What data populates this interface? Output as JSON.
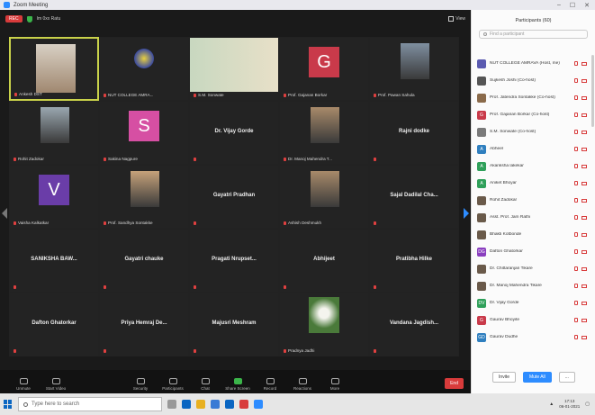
{
  "window": {
    "title": "Zoom Meeting"
  },
  "topbar": {
    "rec_label": "REC",
    "status_text": "Im 0xx Ratu",
    "view_label": "View"
  },
  "tiles": [
    {
      "name": "Ankesh DST",
      "center": "",
      "initial": "",
      "color": "",
      "kind": "photo",
      "active": true
    },
    {
      "name": "NUT COLLEGE AMRA...",
      "center": "",
      "initial": "",
      "color": "",
      "kind": "logo",
      "active": false
    },
    {
      "name": "S.M. Sonwate",
      "center": "",
      "initial": "",
      "color": "",
      "kind": "banner",
      "active": false
    },
    {
      "name": "Prof. Gajanan Borkar",
      "center": "",
      "initial": "G",
      "color": "#c93a4a",
      "kind": "avatar",
      "active": false
    },
    {
      "name": "Prof. Pawan Sahula",
      "center": "",
      "initial": "",
      "color": "",
      "kind": "photo",
      "active": false
    },
    {
      "name": "Rohit Zadokar",
      "center": "",
      "initial": "",
      "color": "",
      "kind": "photo",
      "active": false
    },
    {
      "name": "Sakina Nagpure",
      "center": "",
      "initial": "S",
      "color": "#d64fa3",
      "kind": "avatar",
      "active": false
    },
    {
      "name": "",
      "center": "Dr. Vijay Gorde",
      "initial": "",
      "color": "",
      "kind": "text",
      "active": false
    },
    {
      "name": "Dr. Manoj Mahendra T...",
      "center": "",
      "initial": "",
      "color": "",
      "kind": "photo",
      "active": false
    },
    {
      "name": "",
      "center": "Rajni dodke",
      "initial": "",
      "color": "",
      "kind": "text",
      "active": false
    },
    {
      "name": "Vaisha Kalkatkar",
      "center": "",
      "initial": "V",
      "color": "#6a3da8",
      "kind": "avatar",
      "active": false
    },
    {
      "name": "Prof. Sandhya Sontakke",
      "center": "",
      "initial": "",
      "color": "",
      "kind": "photo",
      "active": false
    },
    {
      "name": "",
      "center": "Gayatri Pradhan",
      "initial": "",
      "color": "",
      "kind": "text",
      "active": false
    },
    {
      "name": "Ashish Deshmukh",
      "center": "",
      "initial": "",
      "color": "",
      "kind": "photo",
      "active": false
    },
    {
      "name": "",
      "center": "Sajal Dadilal Cha...",
      "initial": "",
      "color": "",
      "kind": "text",
      "active": false
    },
    {
      "name": "",
      "center": "SANIKSHA BAW...",
      "initial": "",
      "color": "",
      "kind": "text",
      "active": false
    },
    {
      "name": "",
      "center": "Gayatri chauke",
      "initial": "",
      "color": "",
      "kind": "text",
      "active": false
    },
    {
      "name": "",
      "center": "Pragati Nrupset...",
      "initial": "",
      "color": "",
      "kind": "text",
      "active": false
    },
    {
      "name": "",
      "center": "Abhijeet",
      "initial": "",
      "color": "",
      "kind": "text",
      "active": false
    },
    {
      "name": "",
      "center": "Pratibha Hilke",
      "initial": "",
      "color": "",
      "kind": "text",
      "active": false
    },
    {
      "name": "",
      "center": "Dafton Ghatorkar",
      "initial": "",
      "color": "",
      "kind": "text",
      "active": false
    },
    {
      "name": "",
      "center": "Priya Hemraj De...",
      "initial": "",
      "color": "",
      "kind": "text",
      "active": false
    },
    {
      "name": "",
      "center": "Majusri Meshram",
      "initial": "",
      "color": "",
      "kind": "text",
      "active": false
    },
    {
      "name": "Pradnya Jadhi",
      "center": "",
      "initial": "",
      "color": "",
      "kind": "flower",
      "active": false
    },
    {
      "name": "",
      "center": "Vandana Jagdish...",
      "initial": "",
      "color": "",
      "kind": "text",
      "active": false
    }
  ],
  "toolbar": {
    "items": [
      "Unmute",
      "Start Video",
      "Security",
      "Participants",
      "Chat",
      "Share Screen",
      "Record",
      "Reactions",
      "More"
    ],
    "end_label": "End"
  },
  "panel": {
    "title": "Participants (60)",
    "search_placeholder": "Find a participant",
    "participants": [
      {
        "name": "NUT COLLEGE AMRAVA (Host, me)",
        "initial": "",
        "color": "#5a5ab0"
      },
      {
        "name": "Sujkesh Joshi (Co-host)",
        "initial": "",
        "color": "#555"
      },
      {
        "name": "Prof. Jatendra Sontakke (Co-host)",
        "initial": "",
        "color": "#8a6a4a"
      },
      {
        "name": "Prof. Gajanan Borkar (Co-host)",
        "initial": "G",
        "color": "#c93a4a"
      },
      {
        "name": "S.M. Sonwate (Co-host)",
        "initial": "",
        "color": "#7a7a7a"
      },
      {
        "name": "Abheel",
        "initial": "A",
        "color": "#2f7fbf"
      },
      {
        "name": "Akanksha lakekar",
        "initial": "A",
        "color": "#2fa05a"
      },
      {
        "name": "Aniket Bhoyar",
        "initial": "A",
        "color": "#2fa05a"
      },
      {
        "name": "Rohit Zadokar",
        "initial": "",
        "color": "#6a5a4a"
      },
      {
        "name": "Asst. Prof. Jam Rathi",
        "initial": "",
        "color": "#6a5a4a"
      },
      {
        "name": "Bhakti Kotbonde",
        "initial": "",
        "color": "#6a5a4a"
      },
      {
        "name": "Dafton Ghatorkar",
        "initial": "DG",
        "color": "#8a3fbf"
      },
      {
        "name": "Dr. Chittaranjan Tikare",
        "initial": "",
        "color": "#6a5a4a"
      },
      {
        "name": "Dr. Manoj Mahendra Tikare",
        "initial": "",
        "color": "#6a5a4a"
      },
      {
        "name": "Dr. Vijay Gorde",
        "initial": "DV",
        "color": "#2fa05a"
      },
      {
        "name": "Gaurav Bhoyite",
        "initial": "G",
        "color": "#c93a4a"
      },
      {
        "name": "Gaurav Dudhe",
        "initial": "GD",
        "color": "#2f7fbf"
      }
    ],
    "footer": {
      "invite": "Invite",
      "mute_all": "Mute All",
      "more": "..."
    }
  },
  "taskbar": {
    "search_placeholder": "Type here to search",
    "time": "17:13",
    "date": "06-01-2021"
  }
}
